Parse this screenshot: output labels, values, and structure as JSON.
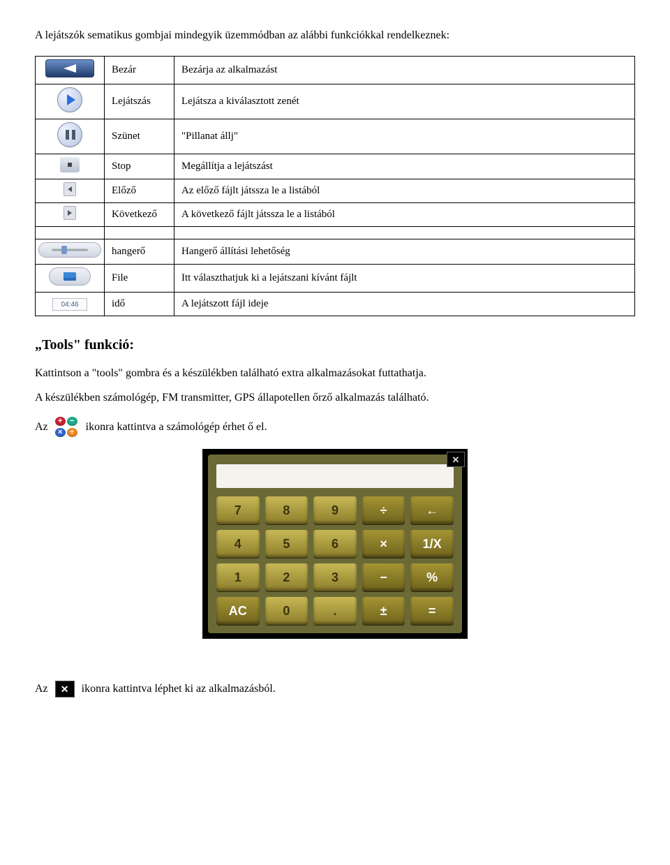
{
  "intro": "A lejátszók sematikus gombjai mindegyik üzemmódban az alábbi funkciókkal rendelkeznek:",
  "table": [
    {
      "icon": "close-back",
      "label": "Bezár",
      "desc": "Bezárja az alkalmazást"
    },
    {
      "icon": "play",
      "label": "Lejátszás",
      "desc": "Lejátsza a kiválasztott zenét"
    },
    {
      "icon": "pause",
      "label": "Szünet",
      "desc": "\"Pillanat állj\""
    },
    {
      "icon": "stop",
      "label": "Stop",
      "desc": "Megállítja a lejátszást"
    },
    {
      "icon": "prev",
      "label": "Előző",
      "desc": "Az előző fájlt játssza le a listából"
    },
    {
      "icon": "next",
      "label": "Következő",
      "desc": "A következő fájlt játssza le a listából"
    }
  ],
  "table2": [
    {
      "icon": "volume",
      "label": "hangerő",
      "desc": "Hangerő állítási lehetőség"
    },
    {
      "icon": "file",
      "label": "File",
      "desc": "Itt választhatjuk ki a lejátszani kívánt fájlt"
    },
    {
      "icon": "time",
      "label": "idő",
      "desc": "A lejátszott fájl  ideje",
      "time_text": "04:46"
    }
  ],
  "tools_heading": "„Tools\" funkció:",
  "tools_p1": "Kattintson a \"tools\" gombra és a készülékben található extra alkalmazásokat futtathatja.",
  "tools_p2": "A készülékben  számológép, FM transmitter, GPS állapotellen őrző alkalmazás található.",
  "line_az1_pre": "Az",
  "line_az1_post": "ikonra kattintva a számológép érhet ő el.",
  "line_az2_pre": "Az",
  "line_az2_post": "ikonra kattintva léphet ki az alkalmazásból.",
  "calc": {
    "ops": {
      "plus": "+",
      "minus": "−",
      "mul": "×",
      "div": "÷",
      "eq": "=",
      "pm": "±"
    },
    "keys": {
      "r1": [
        "7",
        "8",
        "9",
        "÷",
        "←"
      ],
      "r2": [
        "4",
        "5",
        "6",
        "×",
        "1/X"
      ],
      "r3": [
        "1",
        "2",
        "3",
        "−",
        "%"
      ],
      "r4": [
        "AC",
        "0",
        ".",
        "±",
        "="
      ]
    }
  }
}
